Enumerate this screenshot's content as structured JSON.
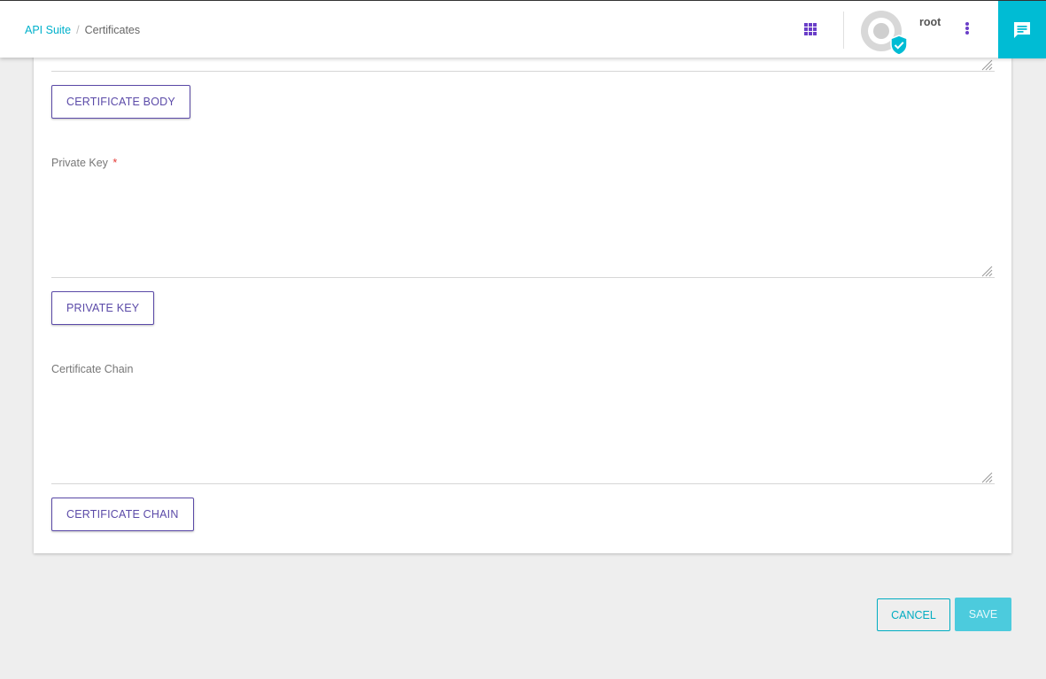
{
  "breadcrumb": {
    "root_label": "API Suite",
    "separator": "/",
    "current_label": "Certificates"
  },
  "header": {
    "username": "root",
    "apps_icon": "apps-grid-icon",
    "more_icon": "more-vertical-icon",
    "chat_icon": "chat-icon",
    "verified_icon": "verified-shield-icon"
  },
  "form": {
    "certificate_body_button": "CERTIFICATE BODY",
    "private_key_label": "Private Key",
    "private_key_required_mark": "*",
    "private_key_value": "",
    "private_key_button": "PRIVATE KEY",
    "certificate_chain_label": "Certificate Chain",
    "certificate_chain_value": "",
    "certificate_chain_button": "CERTIFICATE CHAIN",
    "certificate_body_value": ""
  },
  "actions": {
    "cancel_label": "CANCEL",
    "save_label": "SAVE"
  },
  "colors": {
    "accent": "#00bcd4",
    "primary_purple": "#5b4aa8",
    "required": "#e53935",
    "background": "#eeeeee"
  }
}
